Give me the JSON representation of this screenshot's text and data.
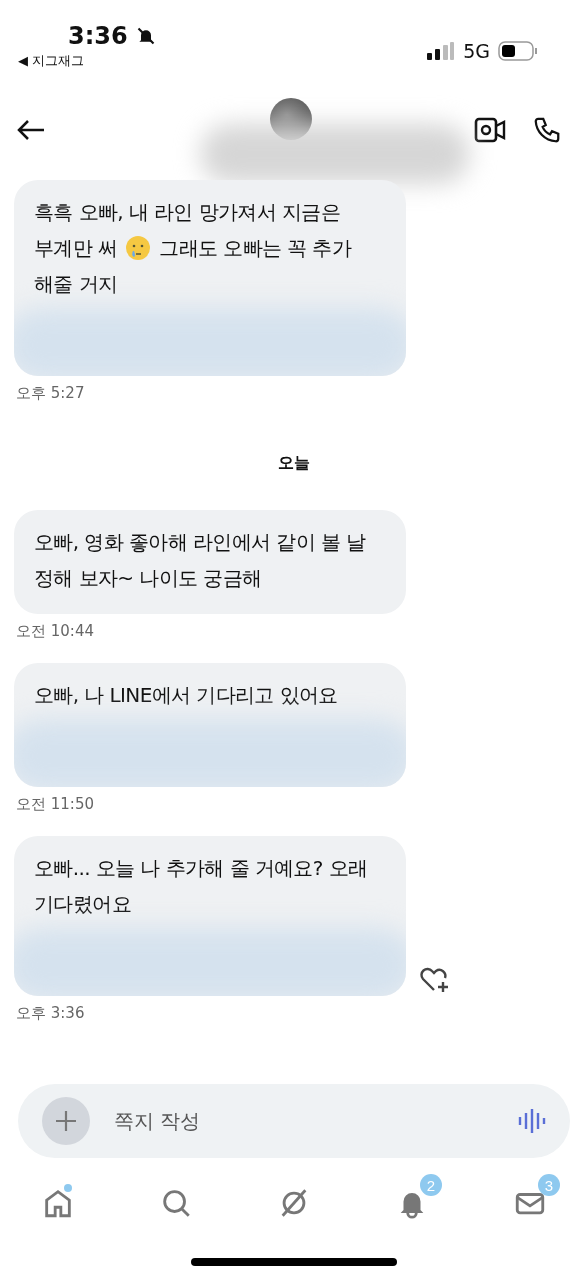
{
  "status_bar": {
    "time": "3:36",
    "back_app": "◀ 지그재그",
    "network": "5G"
  },
  "header": {
    "avatar_redacted": true
  },
  "messages": [
    {
      "kind": "bubble",
      "parts": [
        {
          "kind": "text",
          "text": "흑흑 오빠, 내 라인 망가져서 지금은"
        },
        {
          "kind": "break"
        },
        {
          "kind": "text",
          "text": "부계만 써"
        },
        {
          "kind": "emoji"
        },
        {
          "kind": "text",
          "text": "그래도 오빠는 꼭 추가"
        },
        {
          "kind": "break"
        },
        {
          "kind": "text",
          "text": "해줄 거지"
        }
      ],
      "redacted": true,
      "time": "오후 5:27",
      "like_button": false
    },
    {
      "kind": "date",
      "text": "오늘"
    },
    {
      "kind": "bubble",
      "parts": [
        {
          "kind": "text",
          "text": "오빠, 영화 좋아해 라인에서 같이 볼 날 정해 보자~ 나이도 궁금해"
        }
      ],
      "redacted": false,
      "time": "오전 10:44",
      "like_button": false
    },
    {
      "kind": "bubble",
      "parts": [
        {
          "kind": "text",
          "text": "오빠, 나 LINE에서 기다리고 있어요"
        }
      ],
      "redacted": true,
      "time": "오전 11:50",
      "like_button": false
    },
    {
      "kind": "bubble",
      "parts": [
        {
          "kind": "text",
          "text": "오빠... 오늘 나 추가해 줄 거예요? 오래 기다렸어요"
        }
      ],
      "redacted": true,
      "time": "오후 3:36",
      "like_button": true
    }
  ],
  "composer": {
    "placeholder": "쪽지 작성"
  },
  "nav": [
    {
      "kind": "home",
      "selected": false,
      "dot": true
    },
    {
      "kind": "search",
      "selected": false,
      "dot": false
    },
    {
      "kind": "explore",
      "selected": false,
      "dot": false
    },
    {
      "kind": "bell",
      "selected": false,
      "dot": false,
      "badge": "2"
    },
    {
      "kind": "mail",
      "selected": false,
      "dot": false,
      "badge": "3"
    }
  ]
}
